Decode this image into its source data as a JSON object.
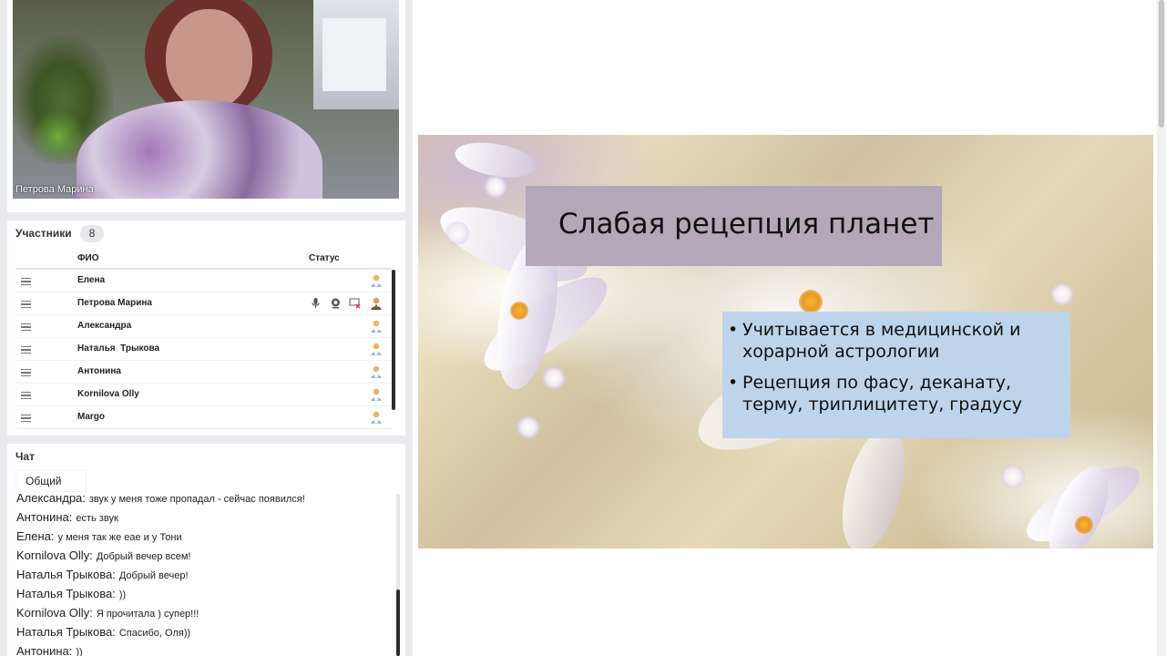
{
  "video": {
    "speaker_name": "Петрова Марина"
  },
  "participants": {
    "title": "Участники",
    "count": "8",
    "columns": {
      "name": "ФИО",
      "status": "Статус"
    },
    "items": [
      {
        "name": "Елена",
        "has_media": false
      },
      {
        "name": "Петрова Марина",
        "has_media": true
      },
      {
        "name": "Александра",
        "has_media": false
      },
      {
        "name": "Наталья  Трыкова",
        "has_media": false
      },
      {
        "name": "Антонина",
        "has_media": false
      },
      {
        "name": "Kornilova Olly",
        "has_media": false
      },
      {
        "name": "Margo",
        "has_media": false
      }
    ]
  },
  "chat": {
    "title": "Чат",
    "tab_label": "Общий",
    "messages": [
      {
        "author": "Александра:",
        "text": "звук у меня тоже пропадал - сейчас появился!"
      },
      {
        "author": "Антонина:",
        "text": "есть звук"
      },
      {
        "author": "Елена:",
        "text": "у меня так же еае и у Тони"
      },
      {
        "author": "Kornilova Olly:",
        "text": "Добрый вечер всем!"
      },
      {
        "author": "Наталья  Трыкова:",
        "text": "Добрый вечер!"
      },
      {
        "author": "Наталья  Трыкова:",
        "text": "))"
      },
      {
        "author": "Kornilova Olly:",
        "text": "Я прочитала ) супер!!!"
      },
      {
        "author": "Наталья  Трыкова:",
        "text": "Спасибо, Оля))"
      },
      {
        "author": "Антонина:",
        "text": "))"
      }
    ]
  },
  "slide": {
    "title": "Слабая рецепция планет",
    "bullets": [
      "Учитывается в медицинской и хорарной астрологии",
      "Рецепция по фасу, деканату, терму, триплицитету, градусу"
    ]
  }
}
